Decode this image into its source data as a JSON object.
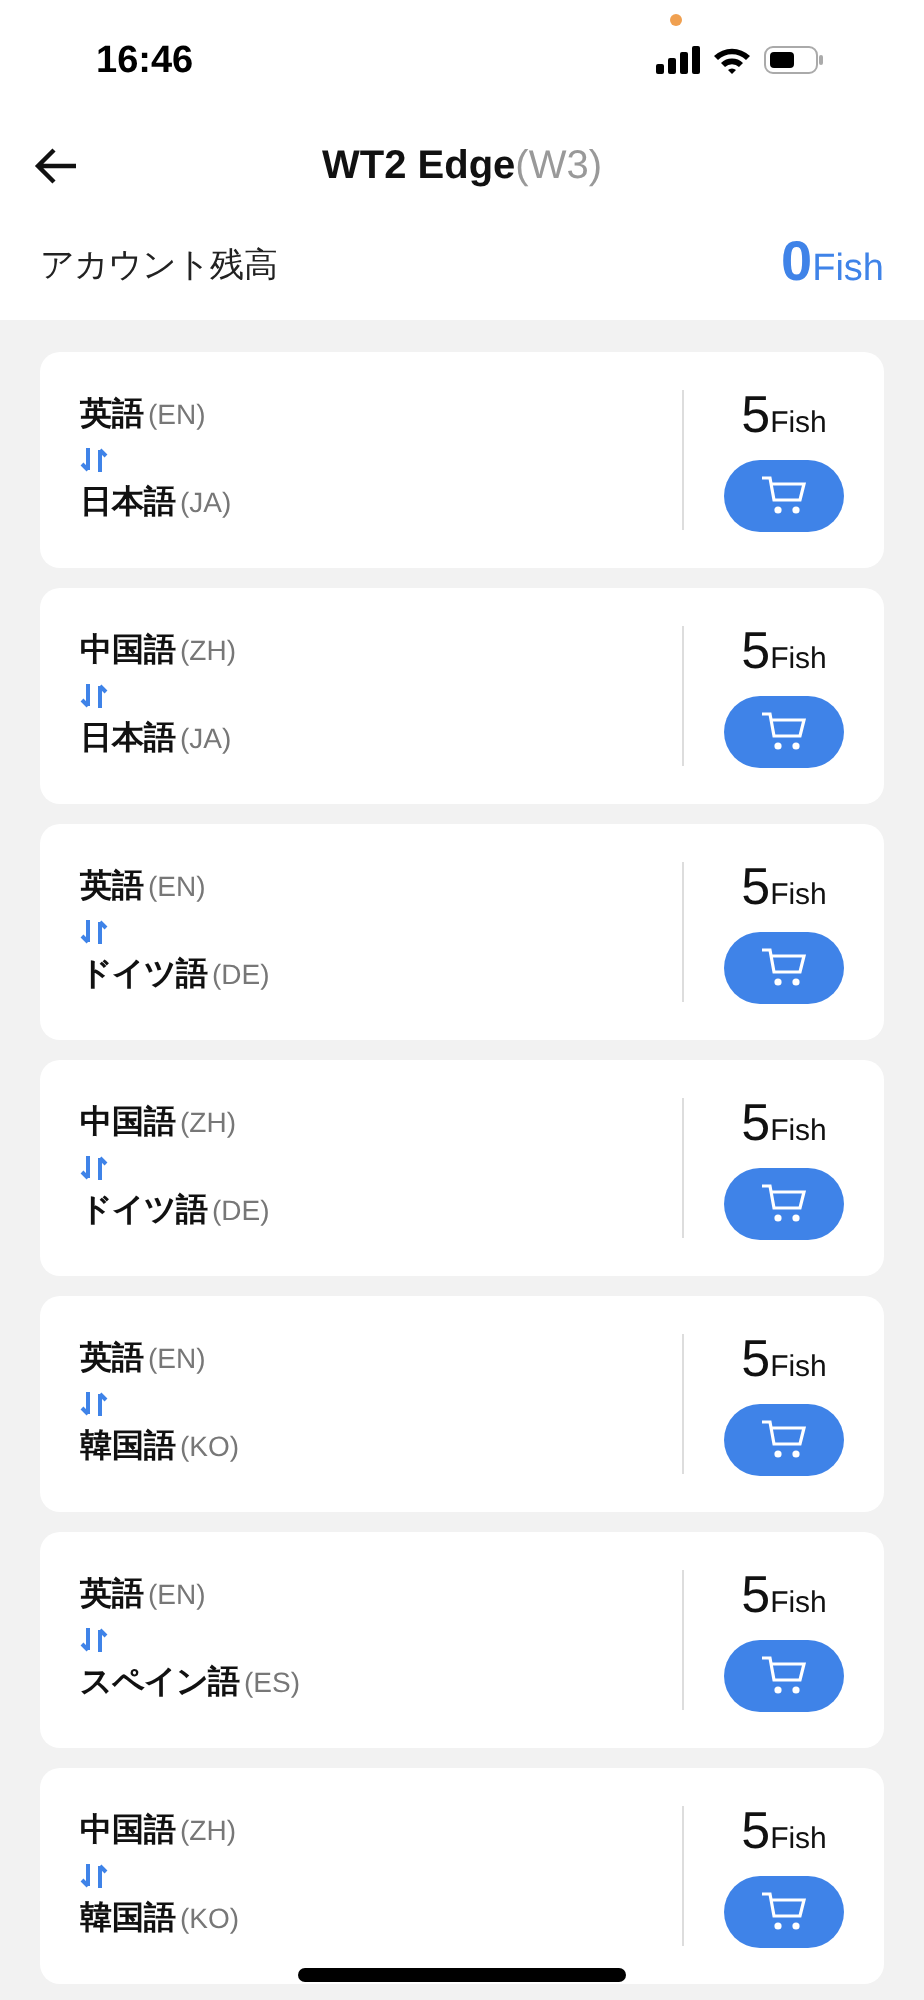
{
  "status_bar": {
    "time": "16:46"
  },
  "header": {
    "title": "WT2 Edge",
    "model": "(W3)"
  },
  "balance": {
    "label": "アカウント残高",
    "amount": "0",
    "unit": "Fish"
  },
  "packs": [
    {
      "from": "英語",
      "from_code": "(EN)",
      "to": "日本語",
      "to_code": "(JA)",
      "price": "5",
      "unit": "Fish"
    },
    {
      "from": "中国語",
      "from_code": "(ZH)",
      "to": "日本語",
      "to_code": "(JA)",
      "price": "5",
      "unit": "Fish"
    },
    {
      "from": "英語",
      "from_code": "(EN)",
      "to": "ドイツ語",
      "to_code": "(DE)",
      "price": "5",
      "unit": "Fish"
    },
    {
      "from": "中国語",
      "from_code": "(ZH)",
      "to": "ドイツ語",
      "to_code": "(DE)",
      "price": "5",
      "unit": "Fish"
    },
    {
      "from": "英語",
      "from_code": "(EN)",
      "to": "韓国語",
      "to_code": "(KO)",
      "price": "5",
      "unit": "Fish"
    },
    {
      "from": "英語",
      "from_code": "(EN)",
      "to": "スペイン語",
      "to_code": "(ES)",
      "price": "5",
      "unit": "Fish"
    },
    {
      "from": "中国語",
      "from_code": "(ZH)",
      "to": "韓国語",
      "to_code": "(KO)",
      "price": "5",
      "unit": "Fish"
    }
  ]
}
